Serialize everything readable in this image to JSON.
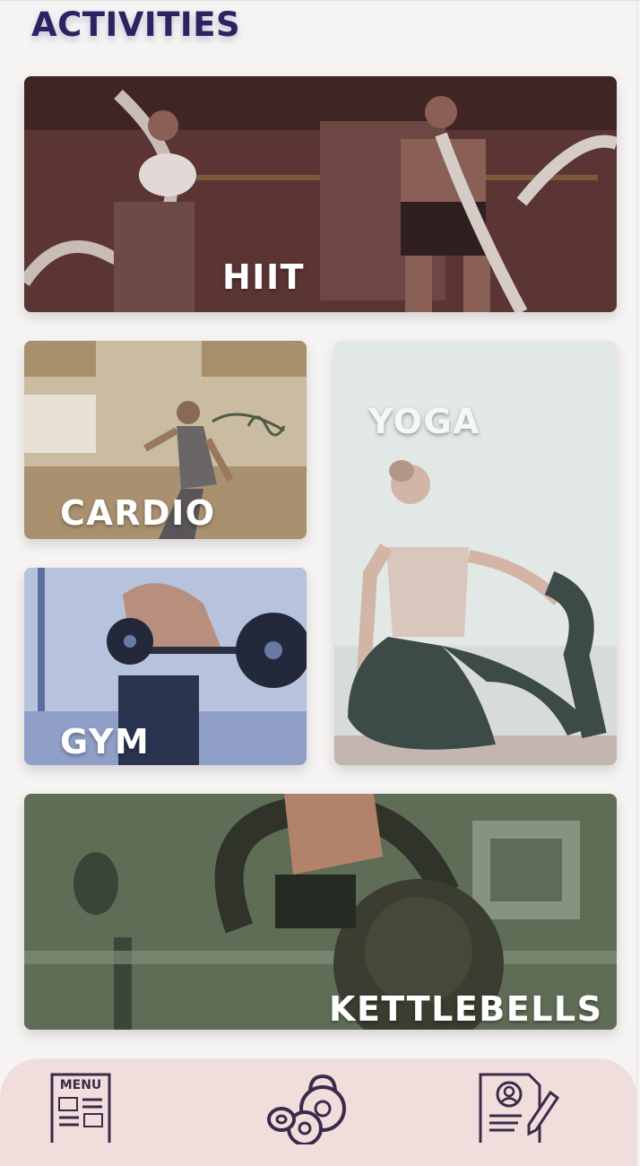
{
  "page": {
    "title": "ACTIVITIES"
  },
  "activities": {
    "hiit": {
      "label": "HIIT"
    },
    "cardio": {
      "label": "CARDIO"
    },
    "yoga": {
      "label": "YOGA"
    },
    "gym": {
      "label": "GYM"
    },
    "kettlebells": {
      "label": "KETTLEBELLS"
    }
  },
  "bottom_nav": {
    "menu_icon_text": "MENU",
    "items": [
      {
        "icon": "menu-board-icon"
      },
      {
        "icon": "kettlebell-icon"
      },
      {
        "icon": "profile-document-icon"
      }
    ]
  },
  "colors": {
    "title": "#2b2463",
    "hiit_tint": "#5a3434",
    "cardio_tint": "#b9a88a",
    "yoga_tint": "#dfe6e4",
    "gym_tint": "#4e66a3",
    "kettle_tint": "#4f5e45",
    "bottom_bar": "#f1dedc",
    "nav_icon": "#3b2b4a"
  }
}
